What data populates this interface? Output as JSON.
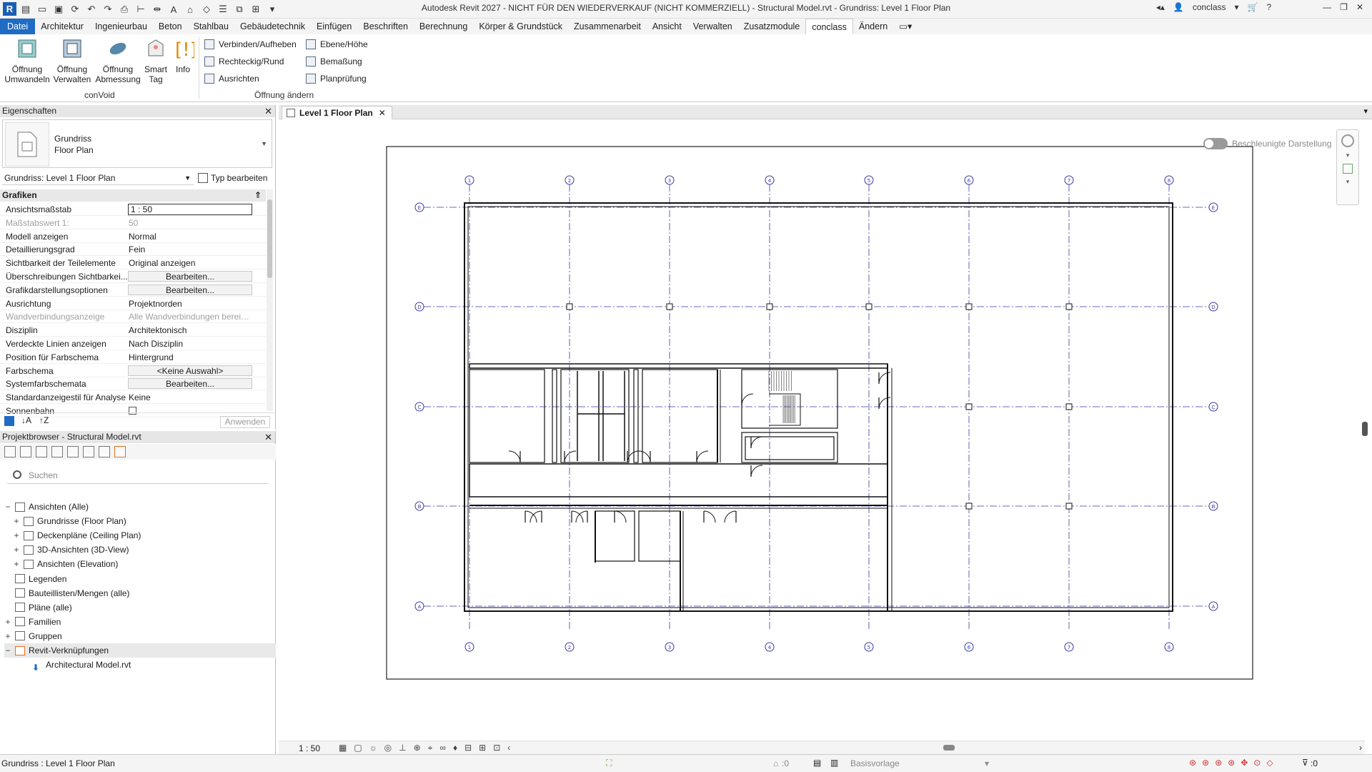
{
  "titlebar": {
    "title": "Autodesk Revit 2027 - NICHT FÜR DEN WIEDERVERKAUF (NICHT KOMMERZIELL) - Structural Model.rvt - Grundriss: Level 1 Floor Plan",
    "user": "conclass",
    "help": "?"
  },
  "menu": {
    "tabs": [
      "Datei",
      "Architektur",
      "Ingenieurbau",
      "Beton",
      "Stahlbau",
      "Gebäudetechnik",
      "Einfügen",
      "Beschriften",
      "Berechnung",
      "Körper & Grundstück",
      "Zusammenarbeit",
      "Ansicht",
      "Verwalten",
      "Zusatzmodule",
      "conclass",
      "Ändern"
    ],
    "active_tab": "conclass"
  },
  "ribbon": {
    "convoid": {
      "panel_title": "conVoid",
      "buttons": [
        {
          "label1": "Öffnung",
          "label2": "Umwandeln"
        },
        {
          "label1": "Öffnung",
          "label2": "Verwalten"
        },
        {
          "label1": "Öffnung",
          "label2": "Abmessung"
        },
        {
          "label1": "Smart",
          "label2": "Tag"
        },
        {
          "label1": "Info",
          "label2": ""
        }
      ]
    },
    "oeffnung": {
      "panel_title": "Öffnung ändern",
      "col1": [
        "Verbinden/Aufheben",
        "Rechteckig/Rund",
        "Ausrichten"
      ],
      "col2": [
        "Ebene/Höhe",
        "Bemaßung",
        "Planprüfung"
      ]
    }
  },
  "properties": {
    "header": "Eigenschaften",
    "type_name_1": "Grundriss",
    "type_name_2": "Floor Plan",
    "selector": "Grundriss: Level 1 Floor Plan",
    "edit_type": "Typ bearbeiten",
    "group": "Grafiken",
    "rows": [
      {
        "k": "Ansichtsmaßstab",
        "v": "1 : 50",
        "kind": "input"
      },
      {
        "k": "Maßstabswert 1:",
        "v": "50",
        "kind": "dim"
      },
      {
        "k": "Modell anzeigen",
        "v": "Normal",
        "kind": "text"
      },
      {
        "k": "Detaillierungsgrad",
        "v": "Fein",
        "kind": "text"
      },
      {
        "k": "Sichtbarkeit der Teilelemente",
        "v": "Original anzeigen",
        "kind": "text"
      },
      {
        "k": "Überschreibungen Sichtbarkei...",
        "v": "Bearbeiten...",
        "kind": "button"
      },
      {
        "k": "Grafikdarstellungsoptionen",
        "v": "Bearbeiten...",
        "kind": "button"
      },
      {
        "k": "Ausrichtung",
        "v": "Projektnorden",
        "kind": "text"
      },
      {
        "k": "Wandverbindungsanzeige",
        "v": "Alle Wandverbindungen berein...",
        "kind": "dim"
      },
      {
        "k": "Disziplin",
        "v": "Architektonisch",
        "kind": "text"
      },
      {
        "k": "Verdeckte Linien anzeigen",
        "v": "Nach Disziplin",
        "kind": "text"
      },
      {
        "k": "Position für Farbschema",
        "v": "Hintergrund",
        "kind": "text"
      },
      {
        "k": "Farbschema",
        "v": "<Keine Auswahl>",
        "kind": "button"
      },
      {
        "k": "Systemfarbschemata",
        "v": "Bearbeiten...",
        "kind": "button"
      },
      {
        "k": "Standardanzeigestil für Analyse",
        "v": "Keine",
        "kind": "text"
      },
      {
        "k": "Sonnenbahn",
        "v": "",
        "kind": "checkbox"
      }
    ],
    "apply": "Anwenden"
  },
  "browser": {
    "header": "Projektbrowser - Structural Model.rvt",
    "search_placeholder": "Suchen",
    "items": [
      {
        "label": "Ansichten (Alle)",
        "exp": "−",
        "indent": 0
      },
      {
        "label": "Grundrisse (Floor Plan)",
        "exp": "+",
        "indent": 1
      },
      {
        "label": "Deckenpläne (Ceiling Plan)",
        "exp": "+",
        "indent": 1
      },
      {
        "label": "3D-Ansichten (3D-View)",
        "exp": "+",
        "indent": 1
      },
      {
        "label": "Ansichten (Elevation)",
        "exp": "+",
        "indent": 1
      },
      {
        "label": "Legenden",
        "exp": "",
        "indent": 0
      },
      {
        "label": "Bauteillisten/Mengen (alle)",
        "exp": "",
        "indent": 0
      },
      {
        "label": "Pläne (alle)",
        "exp": "",
        "indent": 0
      },
      {
        "label": "Familien",
        "exp": "+",
        "indent": 0
      },
      {
        "label": "Gruppen",
        "exp": "+",
        "indent": 0
      },
      {
        "label": "Revit-Verknüpfungen",
        "exp": "−",
        "indent": 0
      },
      {
        "label": "Architectural Model.rvt",
        "exp": "",
        "indent": 2
      }
    ]
  },
  "view": {
    "tab_label": "Level 1 Floor Plan",
    "accel_label": "Beschleunigte Darstellung",
    "scale": "1 : 50",
    "grid_cols": [
      "1",
      "2",
      "3",
      "4",
      "5",
      "6",
      "7",
      "8"
    ],
    "grid_rows": [
      "E",
      "D",
      "C",
      "B",
      "A"
    ]
  },
  "status": {
    "left": "Grundriss : Level 1 Floor Plan",
    "zero": ":0",
    "template": "Basisvorlage",
    "filter": ":0"
  },
  "colors": {
    "accent": "#1f6cc4",
    "grid": "#3a3aa6"
  }
}
